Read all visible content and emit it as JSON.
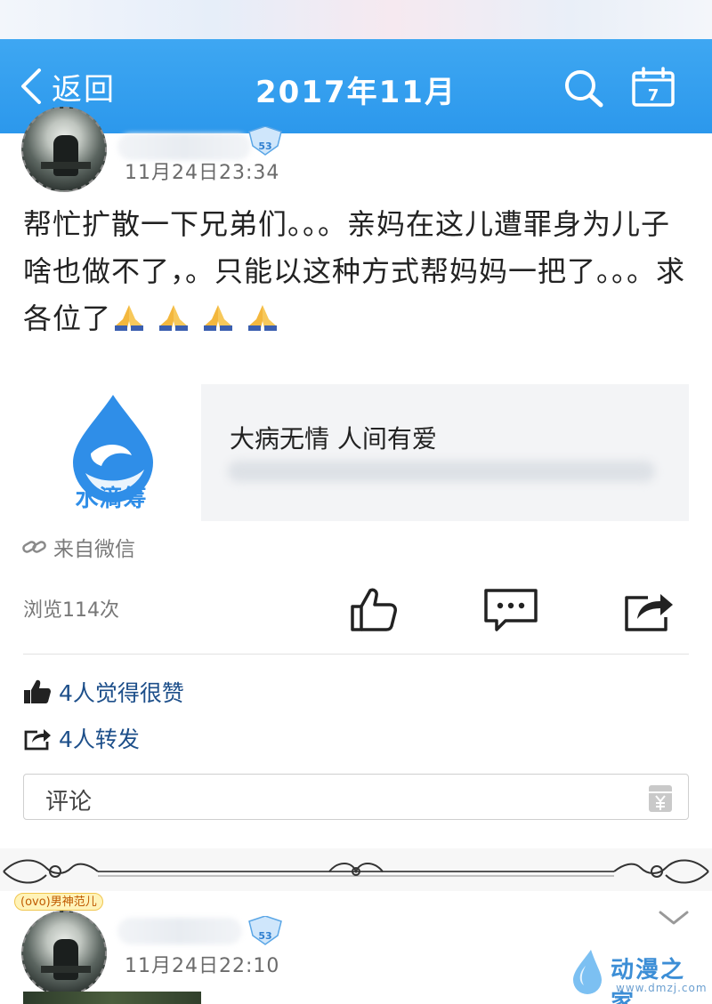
{
  "nav": {
    "back_label": "返回",
    "title": "2017年11月",
    "search_icon": "search-icon",
    "calendar_icon": "calendar-icon",
    "calendar_day": "7"
  },
  "post": {
    "level": "53",
    "time": "11月24日23:34",
    "text": "帮忙扩散一下兄弟们。。。亲妈在这儿遭罪身为儿子啥也做不了，。只能以这种方式帮妈妈一把了。。。求各位了",
    "emoji": "folded-hands",
    "emoji_count": 4,
    "link": {
      "logo_text": "水滴筹",
      "title": "大病无情 人间有爱"
    },
    "source": "来自微信",
    "views": "浏览114次",
    "likes": "4人觉得很赞",
    "shares": "4人转发",
    "comment_placeholder": "评论"
  },
  "second_post": {
    "tag": "(ovo)男神范儿",
    "level": "53",
    "time": "11月24日22:10"
  },
  "watermark": {
    "name": "动漫之家",
    "url": "www.dmzj.com"
  },
  "colors": {
    "nav_bar": "#2f9bee",
    "link_text": "#1d4f8a",
    "logo_blue": "#2f8ee8"
  }
}
